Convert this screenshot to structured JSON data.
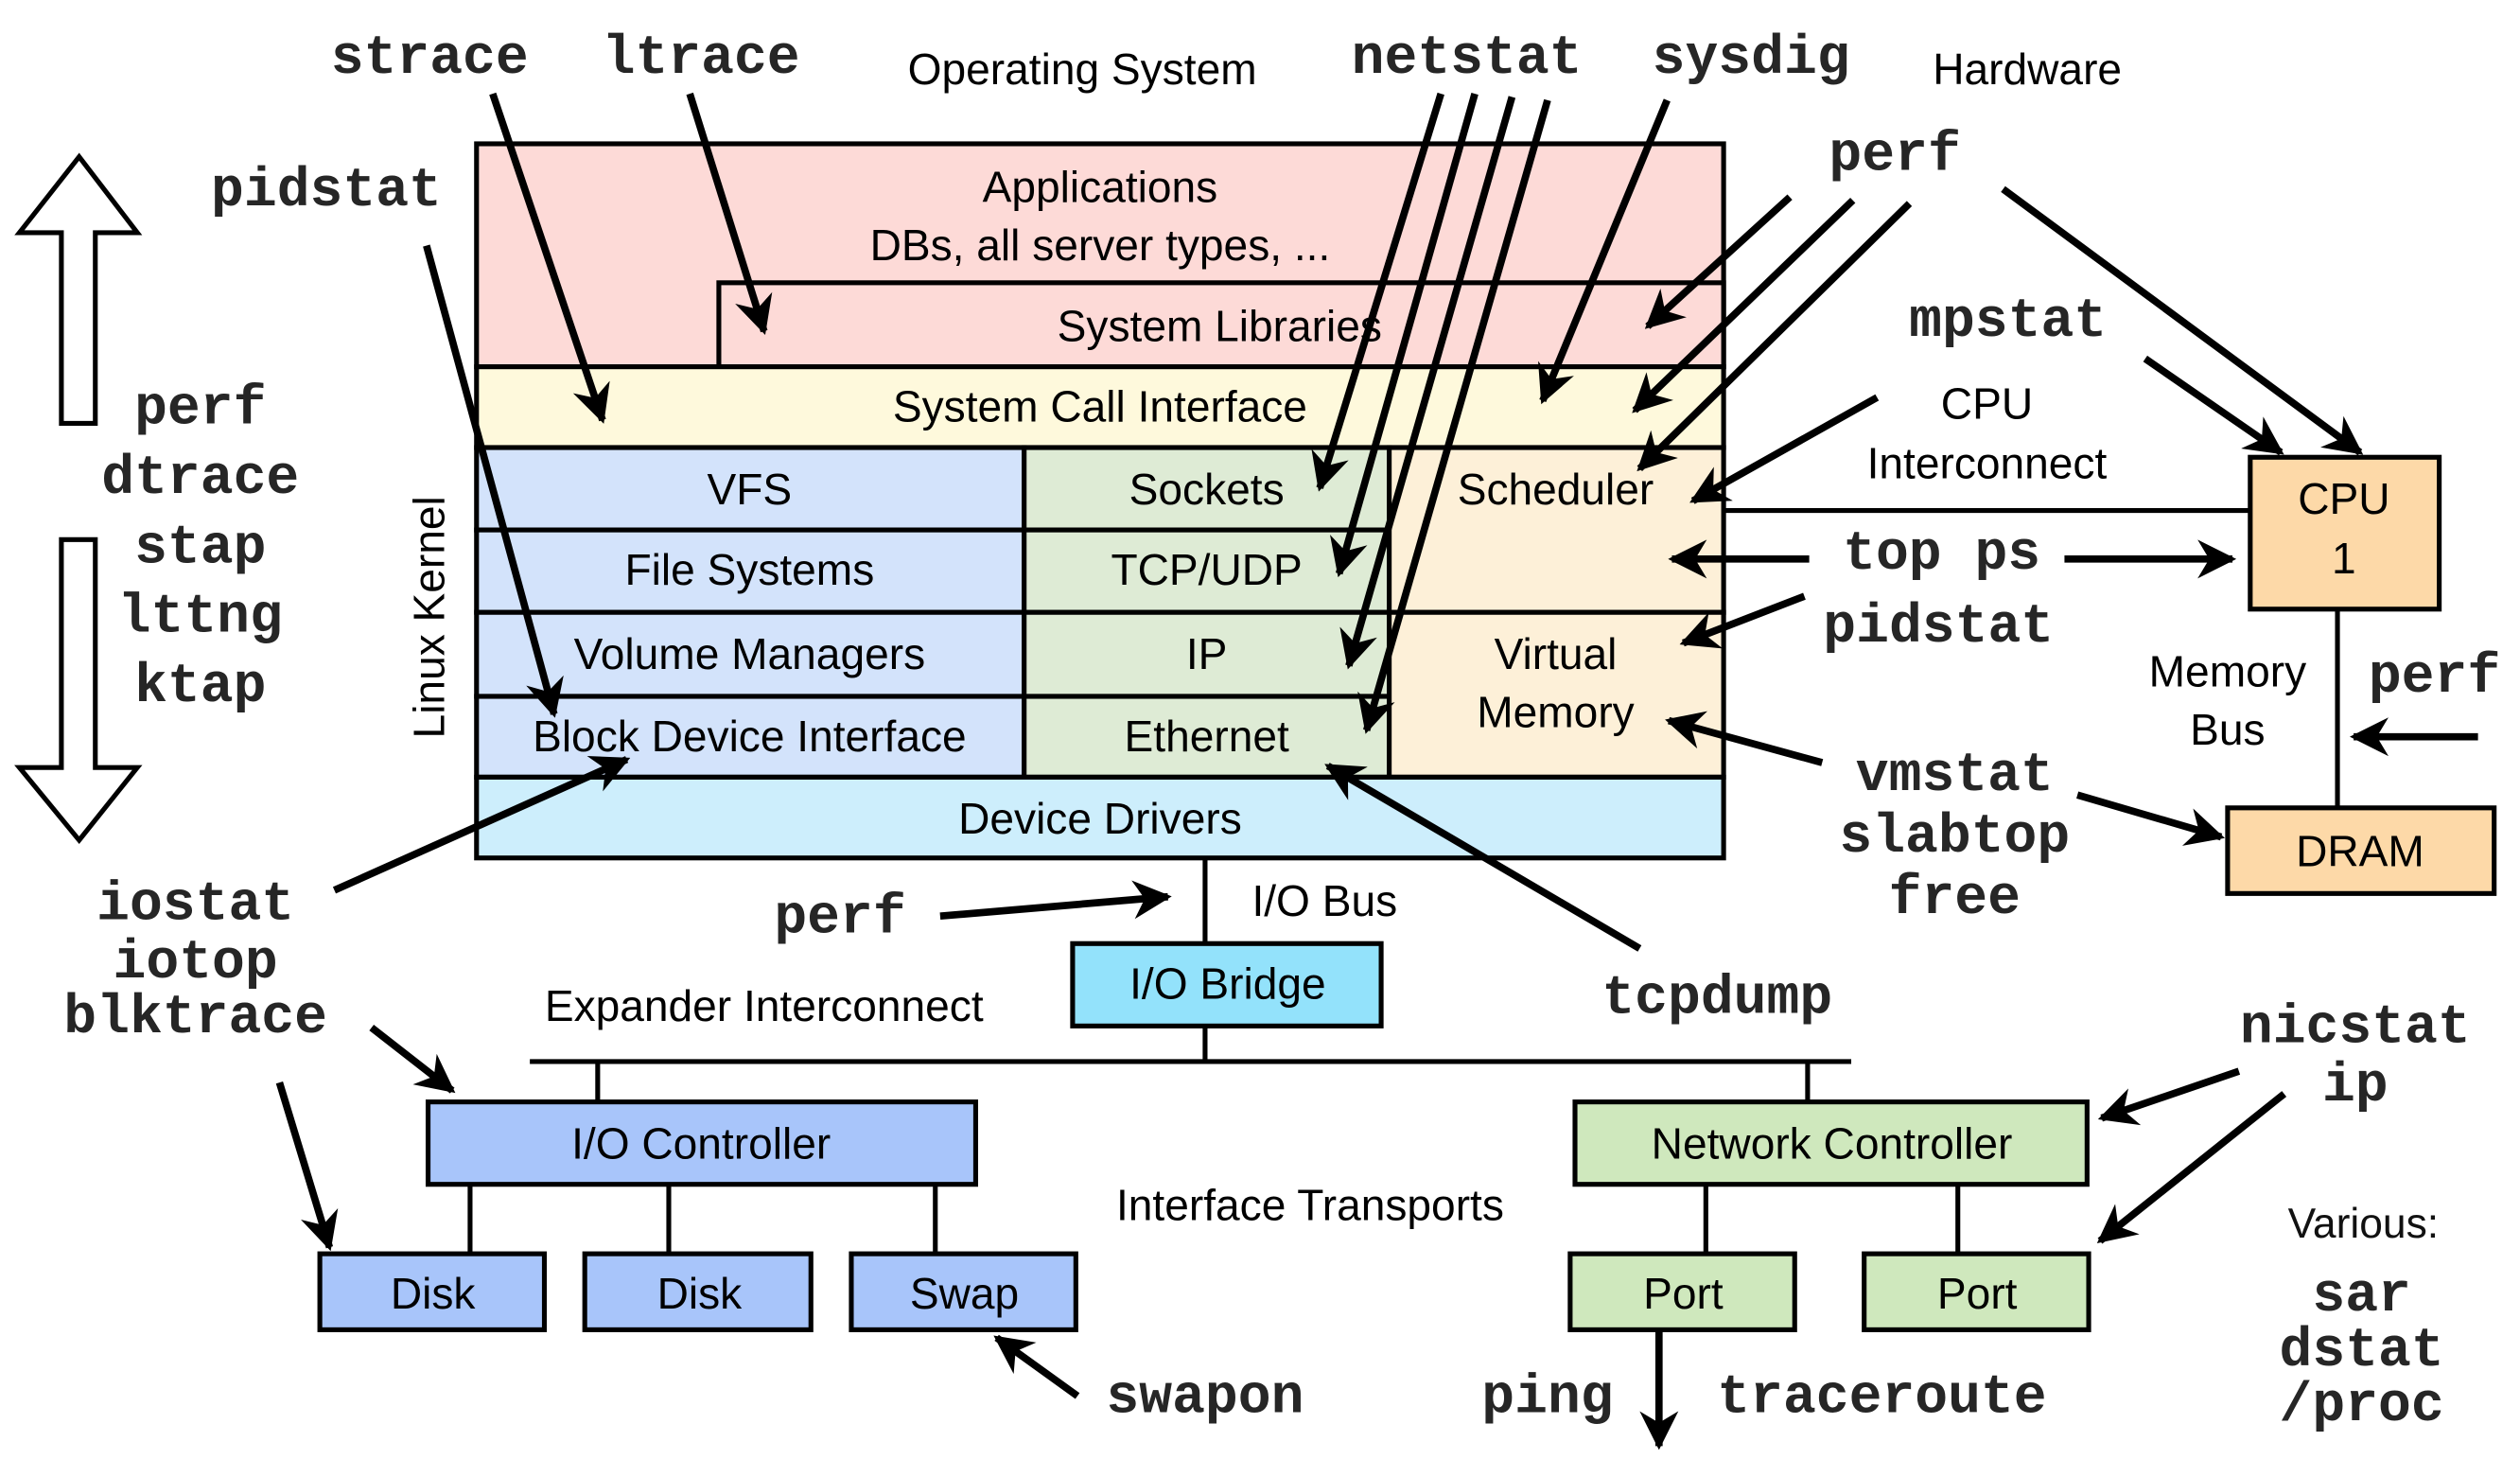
{
  "headers": {
    "operating_system": "Operating System",
    "hardware": "Hardware",
    "linux_kernel": "Linux Kernel"
  },
  "colors": {
    "applications": "#fddad7",
    "syscall": "#fef9dc",
    "fs_stack": "#d3e3fb",
    "net_stack": "#deebd5",
    "sched_vm": "#fdf0d8",
    "device_drivers": "#cdeefc",
    "io_bridge": "#93e2fb",
    "storage": "#a8c5fa",
    "network": "#cfe8bd",
    "cpu_dram": "#fdd9a8",
    "tool_text": "#262626"
  },
  "kernel": {
    "applications_line1": "Applications",
    "applications_line2": "DBs, all server types, ...",
    "system_libraries": "System Libraries",
    "system_call_interface": "System Call Interface",
    "vfs": "VFS",
    "file_systems": "File Systems",
    "volume_managers": "Volume Managers",
    "block_device_interface": "Block Device Interface",
    "sockets": "Sockets",
    "tcp_udp": "TCP/UDP",
    "ip": "IP",
    "ethernet": "Ethernet",
    "scheduler": "Scheduler",
    "virtual_memory_line1": "Virtual",
    "virtual_memory_line2": "Memory",
    "device_drivers": "Device Drivers"
  },
  "hardware": {
    "cpu_line1": "CPU",
    "cpu_line2": "1",
    "dram": "DRAM",
    "cpu_interconnect_line1": "CPU",
    "cpu_interconnect_line2": "Interconnect",
    "memory_bus_line1": "Memory",
    "memory_bus_line2": "Bus",
    "io_bus": "I/O Bus",
    "io_bridge": "I/O Bridge",
    "expander_interconnect": "Expander Interconnect",
    "io_controller": "I/O Controller",
    "disk1": "Disk",
    "disk2": "Disk",
    "swap": "Swap",
    "interface_transports": "Interface Transports",
    "network_controller": "Network Controller",
    "port1": "Port",
    "port2": "Port"
  },
  "tools": {
    "strace": "strace",
    "ltrace": "ltrace",
    "netstat": "netstat",
    "sysdig": "sysdig",
    "pidstat_top": "pidstat",
    "perf_top": "perf",
    "mpstat": "mpstat",
    "tracers": [
      "perf",
      "dtrace",
      "stap",
      "lttng",
      "ktap"
    ],
    "top_ps": "top ps",
    "pidstat_right": "pidstat",
    "perf_membus": "perf",
    "vm_tools": [
      "vmstat",
      "slabtop",
      "free"
    ],
    "io_tools": [
      "iostat",
      "iotop",
      "blktrace"
    ],
    "perf_iobus": "perf",
    "tcpdump": "tcpdump",
    "net_tools": [
      "nicstat",
      "ip"
    ],
    "swapon": "swapon",
    "ping": "ping",
    "traceroute": "traceroute",
    "various_label": "Various:",
    "various": [
      "sar",
      "dstat",
      "/proc"
    ]
  }
}
